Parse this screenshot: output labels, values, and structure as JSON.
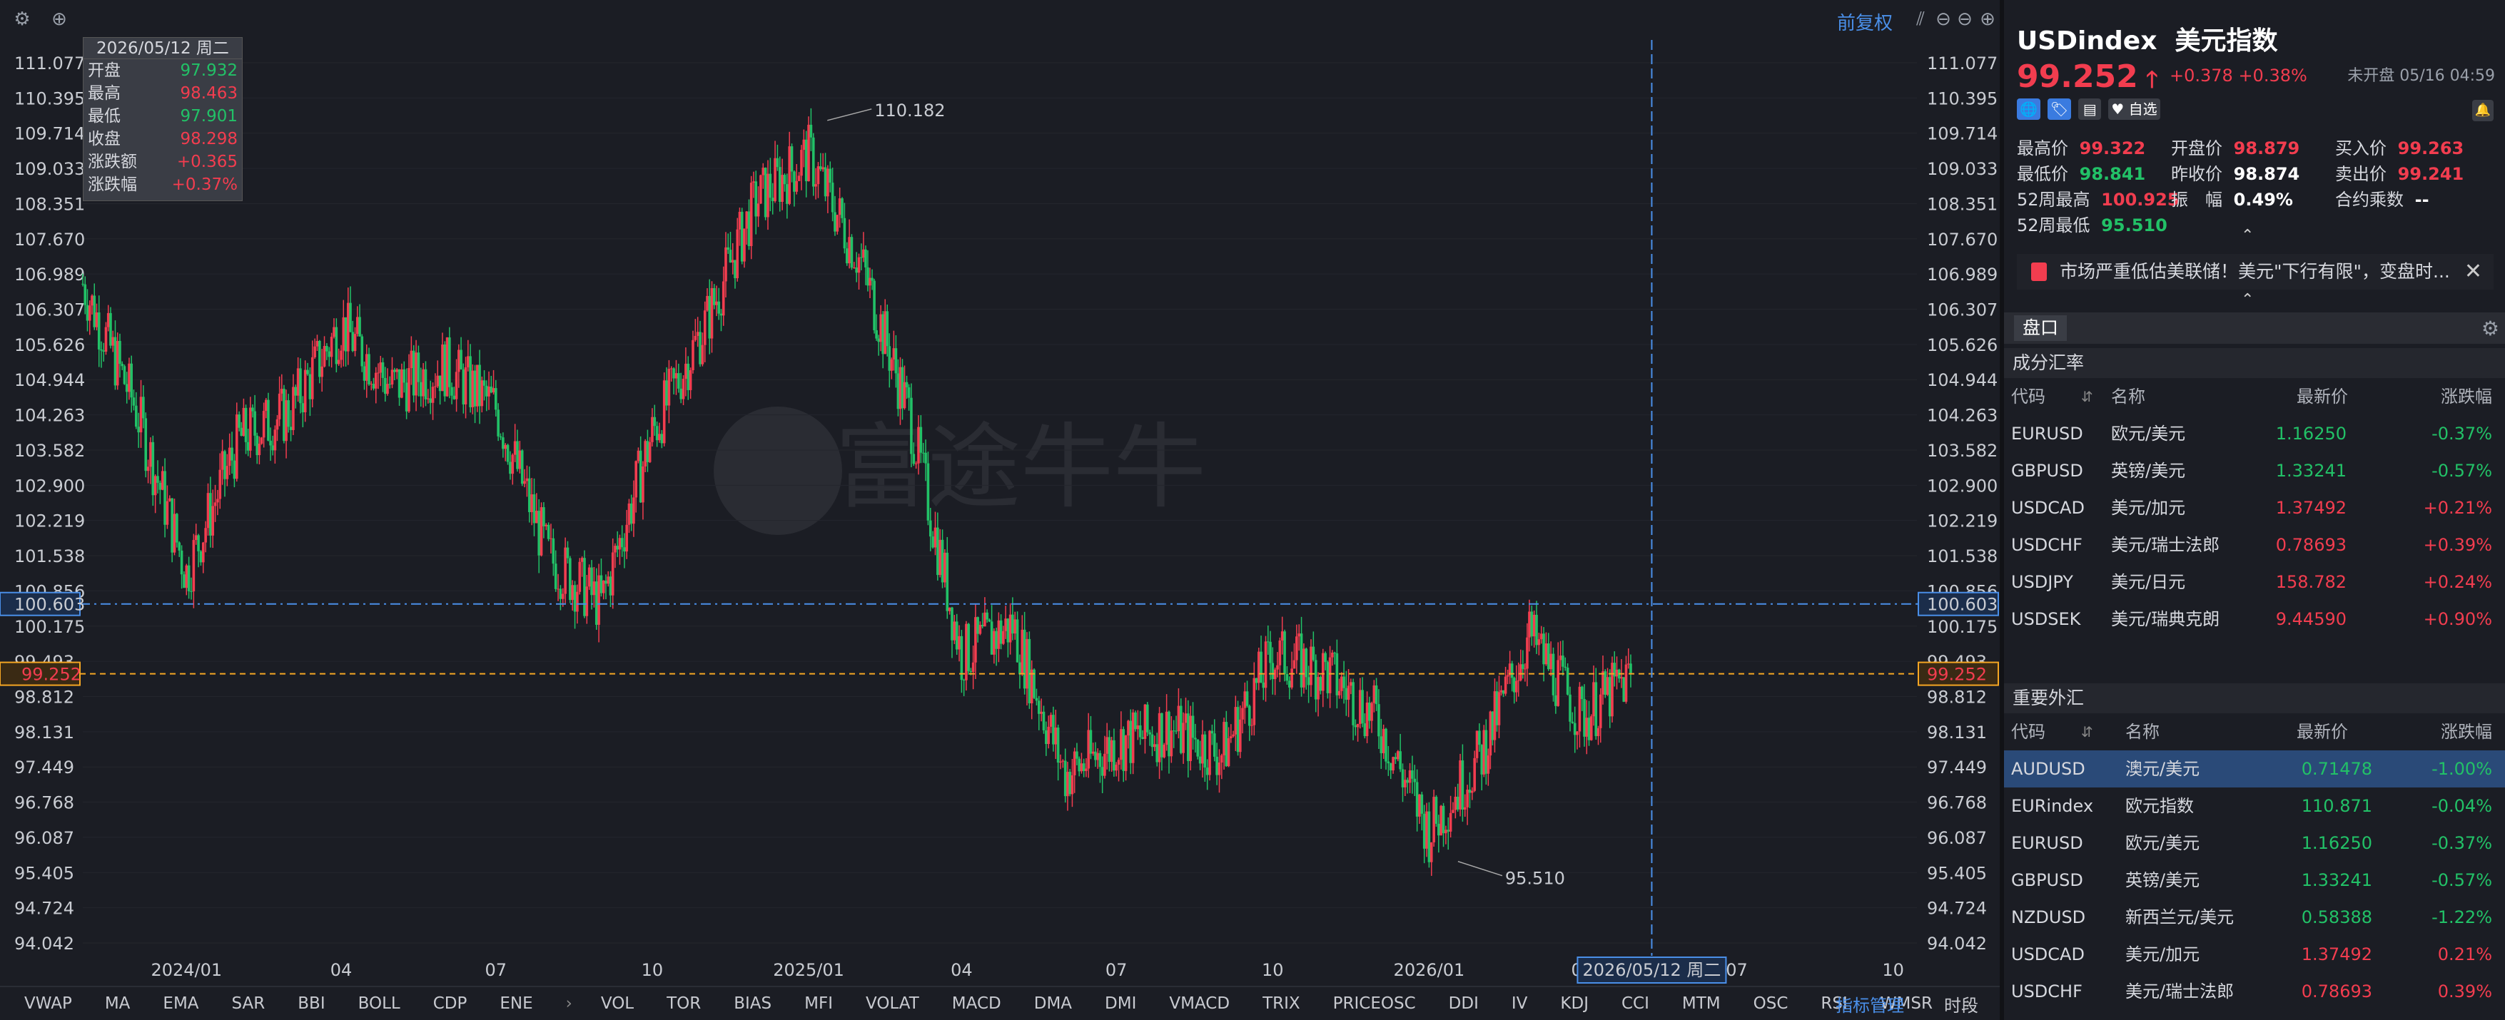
{
  "toolbar": {
    "settings_icon": "gear-icon",
    "add_icon": "plus-icon",
    "adjust_label": "前复权",
    "right_icons": [
      "chart-type-icon",
      "zoom-out-icon",
      "minus-icon",
      "plus-icon"
    ]
  },
  "tooltip": {
    "date": "2026/05/12 周二",
    "rows": [
      {
        "k": "开盘",
        "v": "97.932",
        "color": "green"
      },
      {
        "k": "最高",
        "v": "98.463",
        "color": "red"
      },
      {
        "k": "最低",
        "v": "97.901",
        "color": "green"
      },
      {
        "k": "收盘",
        "v": "98.298",
        "color": "red"
      },
      {
        "k": "涨跌额",
        "v": "+0.365",
        "color": "red"
      },
      {
        "k": "涨跌幅",
        "v": "+0.37%",
        "color": "red"
      }
    ]
  },
  "chart_data": {
    "type": "candlestick",
    "y_ticks": [
      "111.077",
      "110.395",
      "109.714",
      "109.033",
      "108.351",
      "107.670",
      "106.989",
      "106.307",
      "105.626",
      "104.944",
      "104.263",
      "103.582",
      "102.900",
      "102.219",
      "101.538",
      "100.856",
      "100.175",
      "99.493",
      "98.812",
      "98.131",
      "97.449",
      "96.768",
      "96.087",
      "95.405",
      "94.724",
      "94.042"
    ],
    "ylim": [
      94.042,
      111.077
    ],
    "x_ticks": [
      "2024/01",
      "04",
      "07",
      "10",
      "2025/01",
      "04",
      "07",
      "10",
      "2026/01",
      "04",
      "07",
      "10"
    ],
    "annotations": {
      "high": "110.182",
      "low": "95.510"
    },
    "crosshair_price": "100.603",
    "last_price": "99.252",
    "crosshair_date": "2026/05/12 周二",
    "watermark": "富途牛牛",
    "colors": {
      "up": "#f23d4f",
      "down": "#22c167",
      "crosshair": "#4a8fe8",
      "last": "#f5a623"
    },
    "monthly_path": [
      [
        "2023-11",
        106.8
      ],
      [
        "2023-12",
        104.5
      ],
      [
        "2024-01",
        101.2
      ],
      [
        "2024-02",
        103.8
      ],
      [
        "2024-03",
        104.3
      ],
      [
        "2024-04",
        106.0
      ],
      [
        "2024-05",
        104.8
      ],
      [
        "2024-06",
        105.2
      ],
      [
        "2024-07",
        104.4
      ],
      [
        "2024-08",
        101.5
      ],
      [
        "2024-09",
        100.6
      ],
      [
        "2024-10",
        103.9
      ],
      [
        "2024-11",
        106.0
      ],
      [
        "2024-12",
        108.4
      ],
      [
        "2025-01",
        109.3
      ],
      [
        "2025-02",
        107.2
      ],
      [
        "2025-03",
        104.3
      ],
      [
        "2025-04",
        99.6
      ],
      [
        "2025-05",
        100.2
      ],
      [
        "2025-06",
        97.3
      ],
      [
        "2025-07",
        97.9
      ],
      [
        "2025-08",
        98.2
      ],
      [
        "2025-09",
        97.7
      ],
      [
        "2025-10",
        99.6
      ],
      [
        "2025-11",
        99.3
      ],
      [
        "2025-12",
        98.4
      ],
      [
        "2026-01",
        96.2
      ],
      [
        "2026-02",
        97.7
      ],
      [
        "2026-03",
        100.0
      ],
      [
        "2026-04",
        98.4
      ],
      [
        "2026-05",
        99.25
      ]
    ]
  },
  "indicators": [
    "VWAP",
    "MA",
    "EMA",
    "SAR",
    "BBI",
    "BOLL",
    "CDP",
    "ENE",
    "›",
    "VOL",
    "TOR",
    "BIAS",
    "MFI",
    "VOLAT",
    "MACD",
    "DMA",
    "DMI",
    "VMACD",
    "TRIX",
    "PRICEOSC",
    "DDI",
    "IV",
    "KDJ",
    "CCI",
    "MTM",
    "OSC",
    "RSI",
    "WMSR",
    "›"
  ],
  "indicator_manage": "指标管理",
  "time_period": "时段",
  "quote": {
    "code": "USDindex",
    "name": "美元指数",
    "price": "99.252",
    "change": "+0.378 +0.38%",
    "status": "未开盘 05/16 04:59",
    "tags": [
      {
        "t": "🌐",
        "c": "#3a7be0"
      },
      {
        "t": "🏷",
        "c": "#3a7be0"
      },
      {
        "t": "▤",
        "c": "#3a3d45"
      },
      {
        "t": "♥ 自选",
        "c": "#3a3d45"
      }
    ],
    "stats": [
      {
        "k": "最高价",
        "v": "99.322",
        "c": "red"
      },
      {
        "k": "开盘价",
        "v": "98.879",
        "c": "red"
      },
      {
        "k": "买入价",
        "v": "99.263",
        "c": "red"
      },
      {
        "k": "最低价",
        "v": "98.841",
        "c": "green"
      },
      {
        "k": "昨收价",
        "v": "98.874",
        "c": "white"
      },
      {
        "k": "卖出价",
        "v": "99.241",
        "c": "red"
      },
      {
        "k": "52周最高",
        "v": "100.925",
        "c": "red"
      },
      {
        "k": "振　幅",
        "v": "0.49%",
        "c": "white"
      },
      {
        "k": "合约乘数",
        "v": "--",
        "c": "white"
      },
      {
        "k": "52周最低",
        "v": "95.510",
        "c": "green"
      }
    ],
    "news": "市场严重低估美联储！美元\"下行有限\"，变盘时...",
    "pankou": "盘口"
  },
  "components": {
    "title": "成分汇率",
    "headers": [
      "代码",
      "名称",
      "最新价",
      "涨跌幅"
    ],
    "rows": [
      {
        "code": "EURUSD",
        "name": "欧元/美元",
        "price": "1.16250",
        "chg": "-0.37%",
        "c": "green"
      },
      {
        "code": "GBPUSD",
        "name": "英镑/美元",
        "price": "1.33241",
        "chg": "-0.57%",
        "c": "green"
      },
      {
        "code": "USDCAD",
        "name": "美元/加元",
        "price": "1.37492",
        "chg": "+0.21%",
        "c": "red"
      },
      {
        "code": "USDCHF",
        "name": "美元/瑞士法郎",
        "price": "0.78693",
        "chg": "+0.39%",
        "c": "red"
      },
      {
        "code": "USDJPY",
        "name": "美元/日元",
        "price": "158.782",
        "chg": "+0.24%",
        "c": "red"
      },
      {
        "code": "USDSEK",
        "name": "美元/瑞典克朗",
        "price": "9.44590",
        "chg": "+0.90%",
        "c": "red"
      }
    ]
  },
  "forex": {
    "title": "重要外汇",
    "headers": [
      "代码",
      "名称",
      "最新价",
      "涨跌幅"
    ],
    "rows": [
      {
        "code": "AUDUSD",
        "name": "澳元/美元",
        "price": "0.71478",
        "chg": "-1.00%",
        "c": "green"
      },
      {
        "code": "EURindex",
        "name": "欧元指数",
        "price": "110.871",
        "chg": "-0.04%",
        "c": "green"
      },
      {
        "code": "EURUSD",
        "name": "欧元/美元",
        "price": "1.16250",
        "chg": "-0.37%",
        "c": "green"
      },
      {
        "code": "GBPUSD",
        "name": "英镑/美元",
        "price": "1.33241",
        "chg": "-0.57%",
        "c": "green"
      },
      {
        "code": "NZDUSD",
        "name": "新西兰元/美元",
        "price": "0.58388",
        "chg": "-1.22%",
        "c": "green"
      },
      {
        "code": "USDCAD",
        "name": "美元/加元",
        "price": "1.37492",
        "chg": "0.21%",
        "c": "red"
      },
      {
        "code": "USDCHF",
        "name": "美元/瑞士法郎",
        "price": "0.78693",
        "chg": "0.39%",
        "c": "red"
      }
    ]
  }
}
